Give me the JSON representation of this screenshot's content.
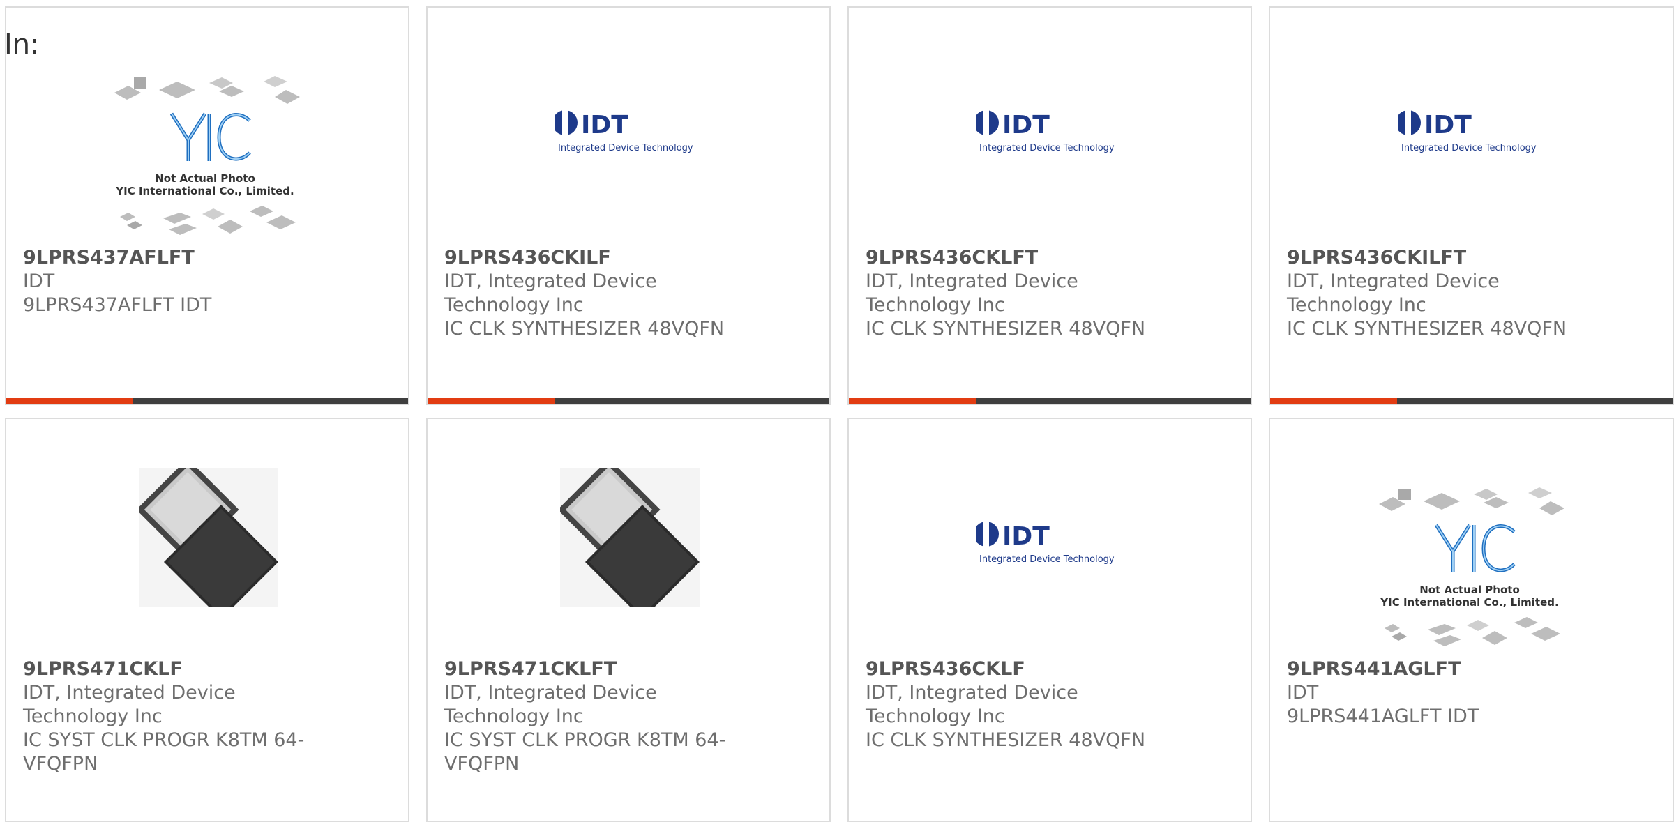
{
  "header": {
    "in_label": "In:"
  },
  "colors": {
    "accent": "#e23c12",
    "bar": "#3f3f3f",
    "idt_blue": "#1e3a8a",
    "yic_blue": "#2a7fd0"
  },
  "cards": [
    {
      "image": "yic-placeholder",
      "image_text_1": "Not Actual Photo",
      "image_text_2": "YIC International Co., Limited.",
      "logo_text": "YIC",
      "part_number": "9LPRS437AFLFT",
      "manufacturer": "IDT",
      "description": "9LPRS437AFLFT IDT"
    },
    {
      "image": "idt-logo",
      "logo_text": "IDT",
      "logo_sub": "Integrated Device Technology",
      "part_number": "9LPRS436CKILF",
      "manufacturer": "IDT, Integrated Device Technology Inc",
      "description": "IC CLK SYNTHESIZER 48VQFN"
    },
    {
      "image": "idt-logo",
      "logo_text": "IDT",
      "logo_sub": "Integrated Device Technology",
      "part_number": "9LPRS436CKLFT",
      "manufacturer": "IDT, Integrated Device Technology Inc",
      "description": "IC CLK SYNTHESIZER 48VQFN"
    },
    {
      "image": "idt-logo",
      "logo_text": "IDT",
      "logo_sub": "Integrated Device Technology",
      "part_number": "9LPRS436CKILFT",
      "manufacturer": "IDT, Integrated Device Technology Inc",
      "description": "IC CLK SYNTHESIZER 48VQFN"
    },
    {
      "image": "qfn-chip-photo",
      "part_number": "9LPRS471CKLF",
      "manufacturer": "IDT, Integrated Device Technology Inc",
      "description": "IC SYST CLK PROGR K8TM 64-VFQFPN"
    },
    {
      "image": "qfn-chip-photo",
      "part_number": "9LPRS471CKLFT",
      "manufacturer": "IDT, Integrated Device Technology Inc",
      "description": "IC SYST CLK PROGR K8TM 64-VFQFPN"
    },
    {
      "image": "idt-logo",
      "logo_text": "IDT",
      "logo_sub": "Integrated Device Technology",
      "part_number": "9LPRS436CKLF",
      "manufacturer": "IDT, Integrated Device Technology Inc",
      "description": "IC CLK SYNTHESIZER 48VQFN"
    },
    {
      "image": "yic-placeholder",
      "image_text_1": "Not Actual Photo",
      "image_text_2": "YIC International Co., Limited.",
      "logo_text": "YIC",
      "part_number": "9LPRS441AGLFT",
      "manufacturer": "IDT",
      "description": "9LPRS441AGLFT IDT"
    }
  ]
}
